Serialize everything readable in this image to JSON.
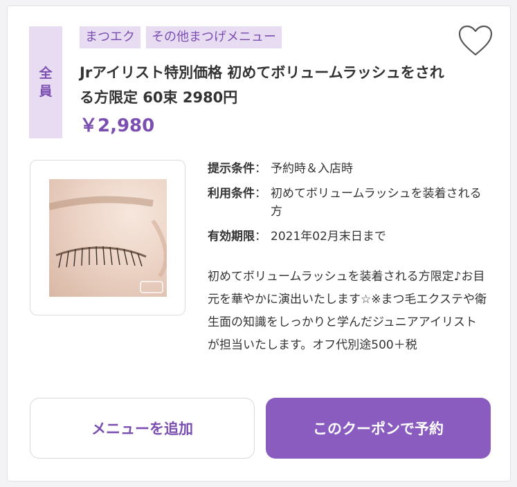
{
  "badge": {
    "chars": [
      "全",
      "員"
    ]
  },
  "tags": [
    "まつエク",
    "その他まつげメニュー"
  ],
  "coupon": {
    "title": "Jrアイリスト特別価格 初めてボリュームラッシュをされる方限定 60束 2980円",
    "price": "￥2,980"
  },
  "conditions": [
    {
      "label": "提示条件",
      "value": "予約時＆入店時"
    },
    {
      "label": "利用条件",
      "value": "初めてボリュームラッシュを装着される方"
    },
    {
      "label": "有効期限",
      "value": "2021年02月末日まで"
    }
  ],
  "description": "初めてボリュームラッシュを装着される方限定♪お目元を華やかに演出いたします☆※まつ毛エクステや衛生面の知識をしっかりと学んだジュニアアイリストが担当いたします。オフ代別途500＋税",
  "buttons": {
    "add_menu": "メニューを追加",
    "reserve": "このクーポンで予約"
  },
  "colors": {
    "accent": "#7b4fb0",
    "accent_light": "#e8dcf3",
    "button": "#8a5cc0"
  },
  "icons": {
    "favorite": "heart-outline-icon"
  }
}
